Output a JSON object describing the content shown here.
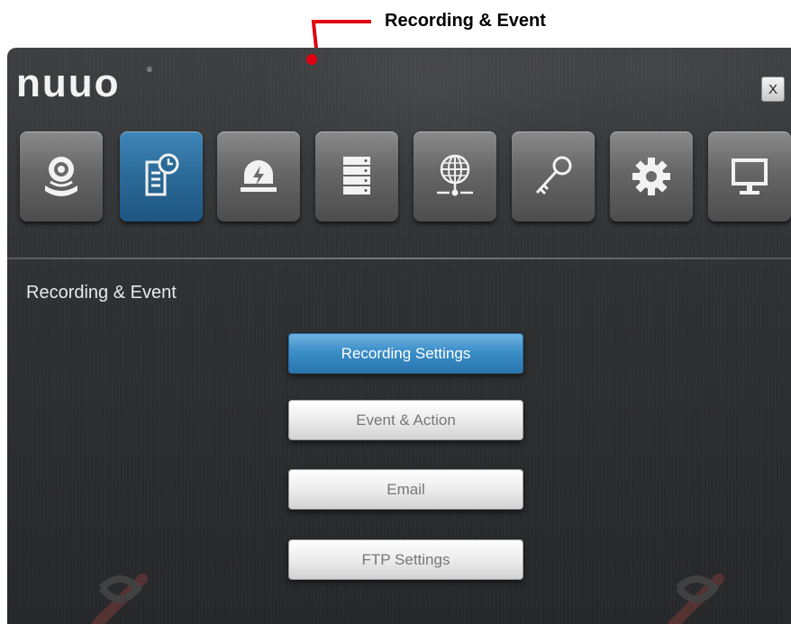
{
  "callout": {
    "label": "Recording & Event"
  },
  "app": {
    "logo": "nuuo",
    "close_label": "X"
  },
  "nav_tiles": [
    {
      "icon": "camera-icon"
    },
    {
      "icon": "recording-schedule-icon",
      "active": true
    },
    {
      "icon": "alarm-icon"
    },
    {
      "icon": "storage-icon"
    },
    {
      "icon": "network-icon"
    },
    {
      "icon": "key-icon"
    },
    {
      "icon": "gear-icon"
    },
    {
      "icon": "monitor-icon"
    }
  ],
  "section": {
    "title": "Recording & Event"
  },
  "menu": [
    {
      "label": "Recording Settings",
      "style": "primary"
    },
    {
      "label": "Event & Action",
      "style": "secondary"
    },
    {
      "label": "Email",
      "style": "secondary"
    },
    {
      "label": "FTP Settings",
      "style": "secondary"
    }
  ],
  "colors": {
    "callout": "#e00010",
    "accent": "#2f7bb2",
    "background": "#2f3032"
  }
}
